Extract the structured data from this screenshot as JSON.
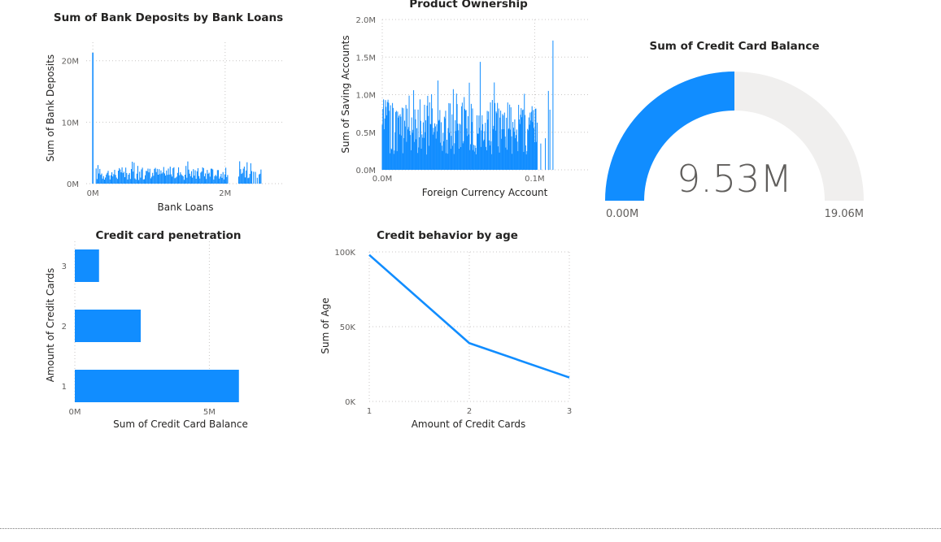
{
  "accent": "#118DFF",
  "chart_data": [
    {
      "type": "bar",
      "title": "Sum of Bank Deposits by Bank Loans",
      "xlabel": "Bank Loans",
      "ylabel": "Sum of Bank Deposits",
      "xticks": [
        "0M",
        "2M"
      ],
      "yticks": [
        "0M",
        "10M",
        "20M"
      ],
      "xlim": [
        -0.1,
        2.9
      ],
      "ylim": [
        0,
        23
      ],
      "spike": {
        "x": 0.0,
        "y": 21.3
      },
      "series_range": {
        "x_start": 0.05,
        "x_end": 2.55,
        "typical_y": [
          0.5,
          3.8
        ]
      },
      "units": "M"
    },
    {
      "type": "bar",
      "title": "Product Ownership",
      "xlabel": "Foreign Currency Account",
      "ylabel": "Sum of Saving Accounts",
      "xticks": [
        "0.0M",
        "0.1M"
      ],
      "yticks": [
        "0.0M",
        "0.5M",
        "1.0M",
        "1.5M",
        "2.0M"
      ],
      "xlim": [
        0,
        0.135
      ],
      "ylim": [
        0,
        2.0
      ],
      "series_range": {
        "x_start": 0.0,
        "x_end": 0.112,
        "typical_y": [
          0.2,
          1.72
        ]
      },
      "units": "M"
    },
    {
      "type": "gauge",
      "title": "Sum of Credit Card Balance",
      "value": 9.53,
      "value_label": "9.53M",
      "min": 0,
      "min_label": "0.00M",
      "max": 19.06,
      "max_label": "19.06M",
      "fill_color": "#118DFF",
      "track_color": "#F0EFEE"
    },
    {
      "type": "bar",
      "orientation": "horizontal",
      "title": "Credit card penetration",
      "xlabel": "Sum of Credit Card Balance",
      "ylabel": "Amount of Credit Cards",
      "categories": [
        "1",
        "2",
        "3"
      ],
      "values": [
        6.1,
        2.45,
        0.9
      ],
      "xticks": [
        "0M",
        "5M"
      ],
      "xlim": [
        0,
        7.8
      ],
      "units": "M"
    },
    {
      "type": "line",
      "title": "Credit behavior by age",
      "xlabel": "Amount of Credit Cards",
      "ylabel": "Sum of Age",
      "x": [
        1,
        2,
        3
      ],
      "y": [
        98000,
        39000,
        16000
      ],
      "xticks": [
        "1",
        "2",
        "3"
      ],
      "yticks": [
        "0K",
        "50K",
        "100K"
      ],
      "ylim": [
        0,
        100000
      ]
    }
  ]
}
